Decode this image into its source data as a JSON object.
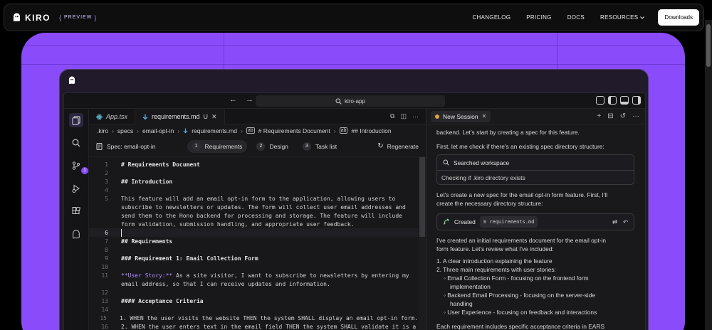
{
  "nav": {
    "logo": "KIRO",
    "preview": "PREVIEW",
    "links": [
      "CHANGELOG",
      "PRICING",
      "DOCS",
      "RESOURCES"
    ],
    "downloads": "Downloads"
  },
  "ide": {
    "title": "kiro-app",
    "badge_count": "1",
    "tabs": [
      {
        "label": "App.tsx"
      },
      {
        "label": "requirements.md",
        "status": "U"
      }
    ],
    "breadcrumbs": [
      ".kiro",
      "specs",
      "email-opt-in",
      "requirements.md",
      "# Requirements Document",
      "## Introduction"
    ],
    "spec_name": "Spec: email-opt-in",
    "steps": [
      {
        "num": "1",
        "label": "Requirements"
      },
      {
        "num": "2",
        "label": "Design"
      },
      {
        "num": "3",
        "label": "Task list"
      }
    ],
    "regenerate": "Regenerate",
    "code_lines": [
      {
        "n": "1",
        "text": "# Requirements Document"
      },
      {
        "n": "2",
        "text": ""
      },
      {
        "n": "3",
        "text": "## Introduction"
      },
      {
        "n": "4",
        "text": ""
      },
      {
        "n": "5",
        "text": "This feature will add an email opt-in form to the application, allowing users to"
      },
      {
        "n": "",
        "text": "subscribe to newsletters or updates. The form will collect user email addresses and"
      },
      {
        "n": "",
        "text": "send them to the Hono backend for processing and storage. The feature will include"
      },
      {
        "n": "",
        "text": "form validation, submission handling, and appropriate user feedback."
      },
      {
        "n": "6",
        "text": ""
      },
      {
        "n": "7",
        "text": "## Requirements"
      },
      {
        "n": "8",
        "text": ""
      },
      {
        "n": "9",
        "text": "### Requirement 1: Email Collection Form"
      },
      {
        "n": "10",
        "text": ""
      },
      {
        "n": "11",
        "text": "**User Story:** As a site visitor, I want to subscribe to newsletters by entering my"
      },
      {
        "n": "",
        "text": "email address, so that I can receive updates and information."
      },
      {
        "n": "12",
        "text": ""
      },
      {
        "n": "13",
        "text": "#### Acceptance Criteria"
      },
      {
        "n": "14",
        "text": ""
      },
      {
        "n": "15",
        "text": "1. WHEN the user visits the website THEN the system SHALL display an email opt-in form."
      },
      {
        "n": "16",
        "text": "2. WHEN the user enters text in the email field THEN the system SHALL validate it is a"
      }
    ],
    "chat": {
      "session": "New Session",
      "p1": "backend. Let's start by creating a spec for this feature.",
      "p2": "First, let me check if there's an existing spec directory structure:",
      "searched": "Searched workspace",
      "checking": "Checking if .kiro directory exists",
      "p3a": "Let's create a new spec for the email opt-in form feature. First, I'll",
      "p3b": "create the necessary directory structure:",
      "created": "Created",
      "created_file": "requirements.md",
      "p4a": "I've created an initial requirements document for the email opt-in",
      "p4b": "form feature. Let's review what I've included:",
      "l1": "1. A clear introduction explaining the feature",
      "l2": "2. Three main requirements with user stories:",
      "s1a": "Email Collection Form - focusing on the frontend form",
      "s1b": "implementation",
      "s2a": "Backend Email Processing - focusing on the server-side",
      "s2b": "handling",
      "s3": "User Experience - focusing on feedback and interactions",
      "p5": "Each requirement includes specific acceptance criteria in EARS"
    }
  },
  "colors": {
    "accent": "#8a4cfb",
    "background": "#000000"
  }
}
